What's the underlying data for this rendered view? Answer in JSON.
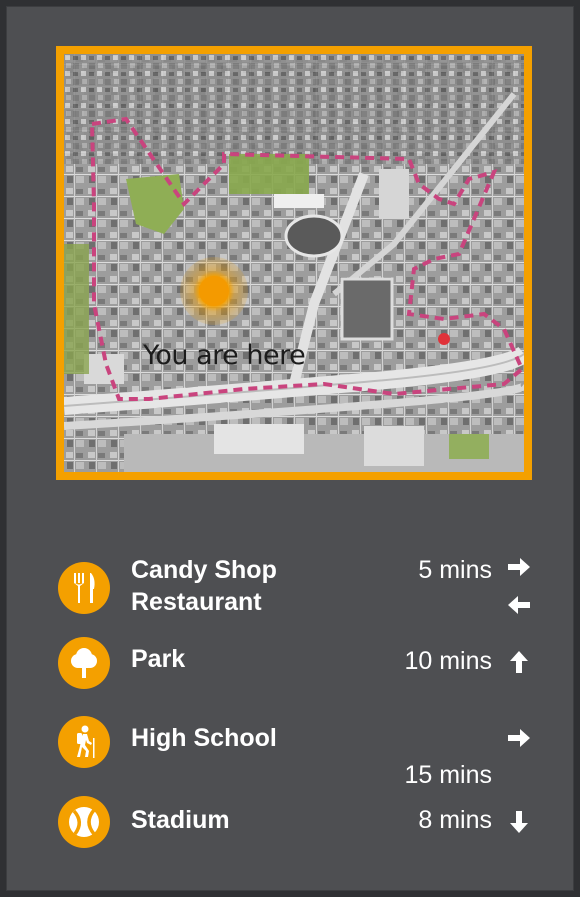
{
  "map": {
    "you_are_here": "You are here"
  },
  "destinations": [
    {
      "name_line1": "Candy Shop",
      "name_line2": "Restaurant",
      "time": "5 mins",
      "icon": "utensils-icon"
    },
    {
      "name_line1": "Park",
      "time": "10 mins",
      "icon": "tree-icon"
    },
    {
      "name_line1": "High School",
      "time": "15 mins",
      "icon": "hiker-icon"
    },
    {
      "name_line1": "Stadium",
      "time": "8 mins",
      "icon": "ball-icon"
    }
  ],
  "colors": {
    "accent": "#f4a000",
    "panel": "#4e4f52",
    "boundary": "#c9447e",
    "marker": "#e0333a"
  }
}
